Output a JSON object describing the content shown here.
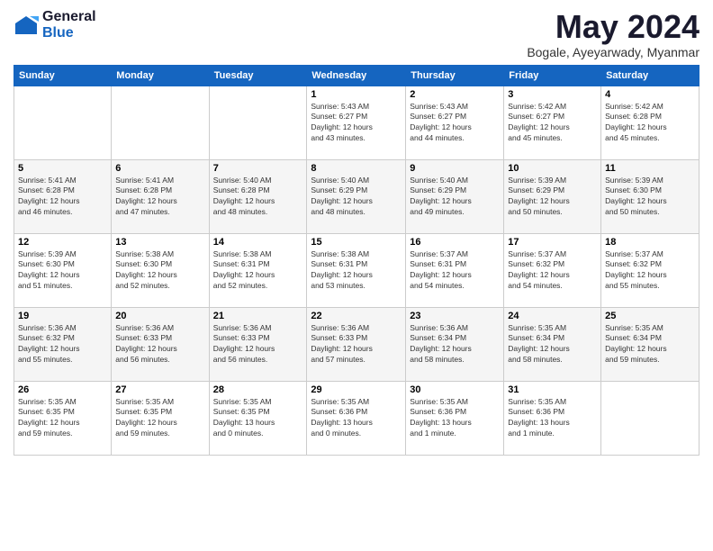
{
  "logo": {
    "general": "General",
    "blue": "Blue"
  },
  "title": "May 2024",
  "subtitle": "Bogale, Ayeyarwady, Myanmar",
  "headers": [
    "Sunday",
    "Monday",
    "Tuesday",
    "Wednesday",
    "Thursday",
    "Friday",
    "Saturday"
  ],
  "weeks": [
    [
      {
        "day": "",
        "info": ""
      },
      {
        "day": "",
        "info": ""
      },
      {
        "day": "",
        "info": ""
      },
      {
        "day": "1",
        "info": "Sunrise: 5:43 AM\nSunset: 6:27 PM\nDaylight: 12 hours\nand 43 minutes."
      },
      {
        "day": "2",
        "info": "Sunrise: 5:43 AM\nSunset: 6:27 PM\nDaylight: 12 hours\nand 44 minutes."
      },
      {
        "day": "3",
        "info": "Sunrise: 5:42 AM\nSunset: 6:27 PM\nDaylight: 12 hours\nand 45 minutes."
      },
      {
        "day": "4",
        "info": "Sunrise: 5:42 AM\nSunset: 6:28 PM\nDaylight: 12 hours\nand 45 minutes."
      }
    ],
    [
      {
        "day": "5",
        "info": "Sunrise: 5:41 AM\nSunset: 6:28 PM\nDaylight: 12 hours\nand 46 minutes."
      },
      {
        "day": "6",
        "info": "Sunrise: 5:41 AM\nSunset: 6:28 PM\nDaylight: 12 hours\nand 47 minutes."
      },
      {
        "day": "7",
        "info": "Sunrise: 5:40 AM\nSunset: 6:28 PM\nDaylight: 12 hours\nand 48 minutes."
      },
      {
        "day": "8",
        "info": "Sunrise: 5:40 AM\nSunset: 6:29 PM\nDaylight: 12 hours\nand 48 minutes."
      },
      {
        "day": "9",
        "info": "Sunrise: 5:40 AM\nSunset: 6:29 PM\nDaylight: 12 hours\nand 49 minutes."
      },
      {
        "day": "10",
        "info": "Sunrise: 5:39 AM\nSunset: 6:29 PM\nDaylight: 12 hours\nand 50 minutes."
      },
      {
        "day": "11",
        "info": "Sunrise: 5:39 AM\nSunset: 6:30 PM\nDaylight: 12 hours\nand 50 minutes."
      }
    ],
    [
      {
        "day": "12",
        "info": "Sunrise: 5:39 AM\nSunset: 6:30 PM\nDaylight: 12 hours\nand 51 minutes."
      },
      {
        "day": "13",
        "info": "Sunrise: 5:38 AM\nSunset: 6:30 PM\nDaylight: 12 hours\nand 52 minutes."
      },
      {
        "day": "14",
        "info": "Sunrise: 5:38 AM\nSunset: 6:31 PM\nDaylight: 12 hours\nand 52 minutes."
      },
      {
        "day": "15",
        "info": "Sunrise: 5:38 AM\nSunset: 6:31 PM\nDaylight: 12 hours\nand 53 minutes."
      },
      {
        "day": "16",
        "info": "Sunrise: 5:37 AM\nSunset: 6:31 PM\nDaylight: 12 hours\nand 54 minutes."
      },
      {
        "day": "17",
        "info": "Sunrise: 5:37 AM\nSunset: 6:32 PM\nDaylight: 12 hours\nand 54 minutes."
      },
      {
        "day": "18",
        "info": "Sunrise: 5:37 AM\nSunset: 6:32 PM\nDaylight: 12 hours\nand 55 minutes."
      }
    ],
    [
      {
        "day": "19",
        "info": "Sunrise: 5:36 AM\nSunset: 6:32 PM\nDaylight: 12 hours\nand 55 minutes."
      },
      {
        "day": "20",
        "info": "Sunrise: 5:36 AM\nSunset: 6:33 PM\nDaylight: 12 hours\nand 56 minutes."
      },
      {
        "day": "21",
        "info": "Sunrise: 5:36 AM\nSunset: 6:33 PM\nDaylight: 12 hours\nand 56 minutes."
      },
      {
        "day": "22",
        "info": "Sunrise: 5:36 AM\nSunset: 6:33 PM\nDaylight: 12 hours\nand 57 minutes."
      },
      {
        "day": "23",
        "info": "Sunrise: 5:36 AM\nSunset: 6:34 PM\nDaylight: 12 hours\nand 58 minutes."
      },
      {
        "day": "24",
        "info": "Sunrise: 5:35 AM\nSunset: 6:34 PM\nDaylight: 12 hours\nand 58 minutes."
      },
      {
        "day": "25",
        "info": "Sunrise: 5:35 AM\nSunset: 6:34 PM\nDaylight: 12 hours\nand 59 minutes."
      }
    ],
    [
      {
        "day": "26",
        "info": "Sunrise: 5:35 AM\nSunset: 6:35 PM\nDaylight: 12 hours\nand 59 minutes."
      },
      {
        "day": "27",
        "info": "Sunrise: 5:35 AM\nSunset: 6:35 PM\nDaylight: 12 hours\nand 59 minutes."
      },
      {
        "day": "28",
        "info": "Sunrise: 5:35 AM\nSunset: 6:35 PM\nDaylight: 13 hours\nand 0 minutes."
      },
      {
        "day": "29",
        "info": "Sunrise: 5:35 AM\nSunset: 6:36 PM\nDaylight: 13 hours\nand 0 minutes."
      },
      {
        "day": "30",
        "info": "Sunrise: 5:35 AM\nSunset: 6:36 PM\nDaylight: 13 hours\nand 1 minute."
      },
      {
        "day": "31",
        "info": "Sunrise: 5:35 AM\nSunset: 6:36 PM\nDaylight: 13 hours\nand 1 minute."
      },
      {
        "day": "",
        "info": ""
      }
    ]
  ]
}
